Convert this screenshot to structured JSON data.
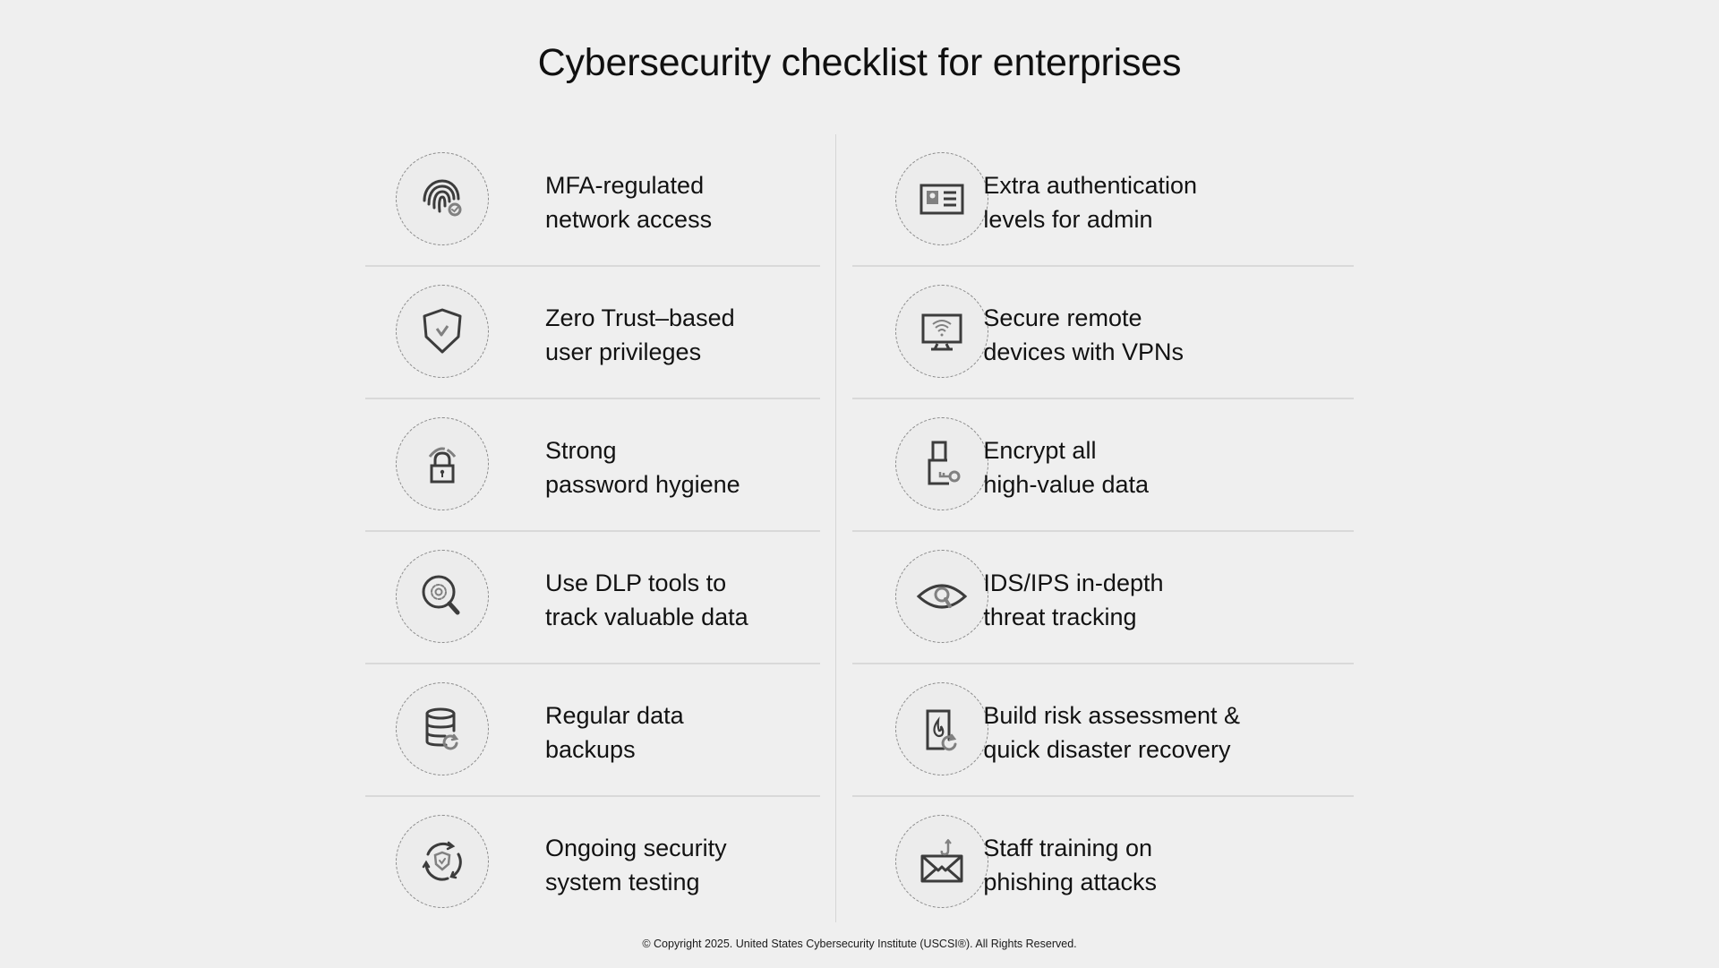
{
  "title": "Cybersecurity checklist for enterprises",
  "items": [
    {
      "icon": "fingerprint-check-icon",
      "line1": "MFA-regulated",
      "line2": "network access"
    },
    {
      "icon": "id-card-icon",
      "line1": "Extra authentication",
      "line2": "levels for admin"
    },
    {
      "icon": "shield-check-icon",
      "line1": "Zero Trust–based",
      "line2": "user privileges"
    },
    {
      "icon": "monitor-wifi-icon",
      "line1": "Secure remote",
      "line2": "devices with VPNs"
    },
    {
      "icon": "padlock-icon",
      "line1": "Strong",
      "line2": "password hygiene"
    },
    {
      "icon": "usb-key-icon",
      "line1": "Encrypt all",
      "line2": "high-value data"
    },
    {
      "icon": "magnifier-gear-icon",
      "line1": "Use DLP tools to",
      "line2": "track valuable data"
    },
    {
      "icon": "eye-magnifier-icon",
      "line1": "IDS/IPS in-depth",
      "line2": "threat tracking"
    },
    {
      "icon": "database-refresh-icon",
      "line1": "Regular data",
      "line2": "backups"
    },
    {
      "icon": "document-fire-recovery-icon",
      "line1": "Build risk assessment &",
      "line2": "quick disaster recovery"
    },
    {
      "icon": "shield-cycle-icon",
      "line1": "Ongoing security",
      "line2": "system testing"
    },
    {
      "icon": "envelope-hook-icon",
      "line1": "Staff training on",
      "line2": "phishing attacks"
    }
  ],
  "footer": "© Copyright 2025. United States Cybersecurity Institute (USCSI®). All Rights Reserved.",
  "colors": {
    "background": "#efefef",
    "icon_dark": "#3c3c3c",
    "icon_mid": "#808080",
    "divider": "#d9d9d9"
  }
}
